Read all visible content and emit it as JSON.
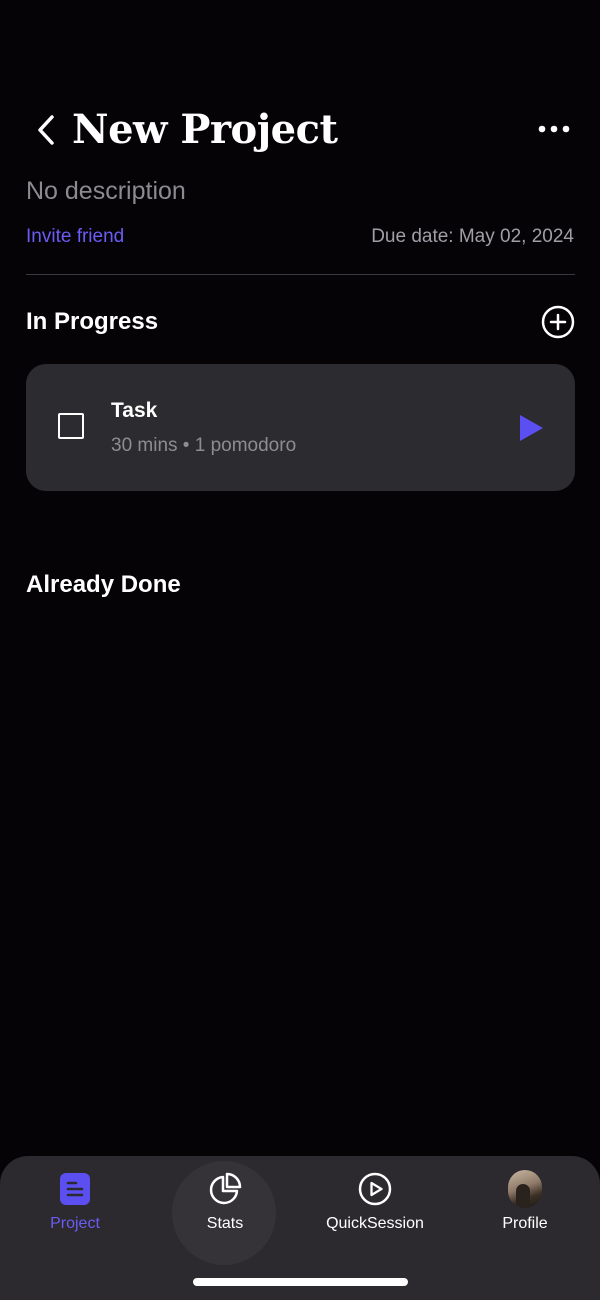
{
  "header": {
    "title": "New Project",
    "back_icon": "chevron-left-icon",
    "more_icon": "more-horizontal-icon"
  },
  "project": {
    "description": "No description",
    "invite_label": "Invite friend",
    "due_date": "Due date: May 02, 2024"
  },
  "sections": {
    "in_progress": "In Progress",
    "already_done": "Already Done"
  },
  "tasks": [
    {
      "title": "Task",
      "meta": "30 mins • 1 pomodoro",
      "completed": false
    }
  ],
  "tab_bar": {
    "tabs": [
      {
        "label": "Project",
        "icon": "document-icon",
        "active": true
      },
      {
        "label": "Stats",
        "icon": "pie-chart-icon",
        "active": false
      },
      {
        "label": "QuickSession",
        "icon": "play-circle-icon",
        "active": false
      },
      {
        "label": "Profile",
        "icon": "avatar",
        "active": false
      }
    ]
  },
  "colors": {
    "background": "#050306",
    "accent": "#6a5cf5",
    "card": "#2c2b2f",
    "muted_text": "#8e8c93"
  }
}
